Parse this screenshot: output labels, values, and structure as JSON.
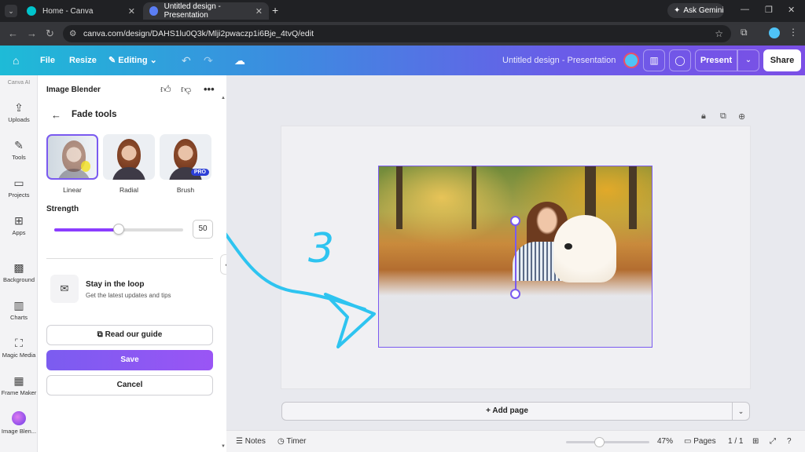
{
  "browser": {
    "tabs": [
      {
        "title": "Home - Canva"
      },
      {
        "title": "Untitled design - Presentation"
      }
    ],
    "ask_gemini": "Ask Gemini",
    "url": "canva.com/design/DAHS1lu0Q3k/Mlji2pwaczp1i6Bje_4tvQ/edit"
  },
  "topbar": {
    "file": "File",
    "resize": "Resize",
    "editing": "Editing",
    "doc_title": "Untitled design - Presentation",
    "present": "Present",
    "share": "Share"
  },
  "rail": {
    "canva_ai": "Canva AI",
    "items": [
      {
        "label": "Uploads",
        "icon": "upload-cloud-icon"
      },
      {
        "label": "Tools",
        "icon": "pen-icon"
      },
      {
        "label": "Projects",
        "icon": "folder-icon"
      },
      {
        "label": "Apps",
        "icon": "apps-grid-icon"
      },
      {
        "label": "Background",
        "icon": "background-pattern-icon"
      },
      {
        "label": "Charts",
        "icon": "bar-chart-icon"
      },
      {
        "label": "Magic Media",
        "icon": "magic-media-icon"
      },
      {
        "label": "Frame Maker",
        "icon": "frame-maker-icon"
      },
      {
        "label": "Image Blen...",
        "icon": "image-blender-icon"
      }
    ]
  },
  "panel": {
    "title": "Image Blender",
    "section_title": "Fade tools",
    "tools": [
      {
        "label": "Linear",
        "selected": true
      },
      {
        "label": "Radial",
        "selected": false
      },
      {
        "label": "Brush",
        "selected": false,
        "badge": "PRO"
      }
    ],
    "strength_label": "Strength",
    "strength_value": "50",
    "strength_fraction": 0.5,
    "loop_title": "Stay in the loop",
    "loop_subtitle": "Get the latest updates and tips",
    "guide_button": "Read our guide",
    "save_button": "Save",
    "cancel_button": "Cancel"
  },
  "canvas": {
    "add_page": "+ Add page",
    "annotation_text": "3"
  },
  "bottombar": {
    "notes": "Notes",
    "timer": "Timer",
    "zoom": "47%",
    "zoom_fraction": 0.4,
    "pages": "Pages",
    "page_count": "1 / 1"
  },
  "colors": {
    "accent": "#8b3dff",
    "selection": "#7a5af0",
    "annotation": "#2ec4f0"
  }
}
